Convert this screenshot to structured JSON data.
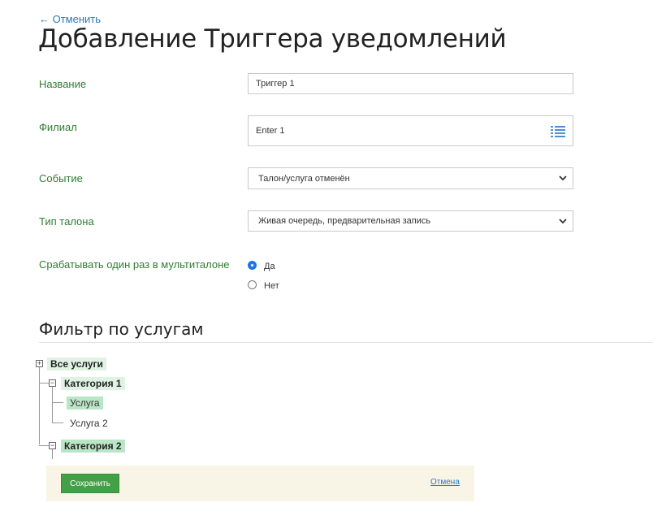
{
  "header": {
    "back_label": "← Отменить",
    "title": "Добавление Триггера уведомлений"
  },
  "form": {
    "name": {
      "label": "Название",
      "value": "Триггер 1"
    },
    "branch": {
      "label": "Филиал",
      "value": "Enter 1"
    },
    "event": {
      "label": "Событие",
      "selected": "Талон/услуга отменён"
    },
    "ticket_type": {
      "label": "Тип талона",
      "selected": "Живая очередь, предварительная запись"
    },
    "multi": {
      "label": "Срабатывать один раз в мультиталоне",
      "options": [
        {
          "label": "Да",
          "checked": true
        },
        {
          "label": "Нет",
          "checked": false
        }
      ]
    }
  },
  "filter": {
    "title": "Фильтр по услугам",
    "tree": {
      "root": "Все услуги",
      "category1": "Категория 1",
      "service1": "Услуга",
      "service2": "Услуга 2",
      "category2": "Категория 2"
    }
  },
  "footer": {
    "save_label": "Сохранить",
    "cancel_label": "Отмена"
  },
  "colors": {
    "accent_green": "#43a047",
    "label_green": "#2e7d32",
    "link_blue": "#2f78b7",
    "radio_blue": "#1a73e8"
  }
}
